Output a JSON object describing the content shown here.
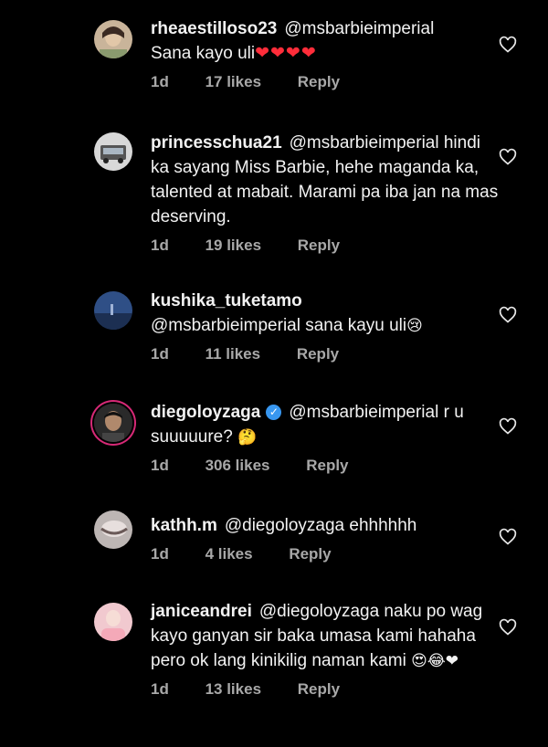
{
  "comments": [
    {
      "username": "rheaestilloso23",
      "text": "@msbarbieimperial\nSana kayo uli",
      "emojis": "❤❤❤❤",
      "age": "1d",
      "likes": "17 likes",
      "reply": "Reply",
      "verified": false
    },
    {
      "username": "princesschua21",
      "text": "@msbarbieimperial hindi ka sayang Miss Barbie, hehe maganda ka, talented at mabait. Marami pa iba jan na mas deserving.",
      "emojis": "",
      "age": "1d",
      "likes": "19 likes",
      "reply": "Reply",
      "verified": false
    },
    {
      "username": "kushika_tuketamo",
      "text": "@msbarbieimperial sana kayu uli",
      "emojis": "😢",
      "age": "1d",
      "likes": "11 likes",
      "reply": "Reply",
      "verified": false
    },
    {
      "username": "diegoloyzaga",
      "text": "@msbarbieimperial r u suuuuure?",
      "emojis": "🤔",
      "age": "1d",
      "likes": "306 likes",
      "reply": "Reply",
      "verified": true
    },
    {
      "username": "kathh.m",
      "text": "@diegoloyzaga ehhhhhh",
      "emojis": "",
      "age": "1d",
      "likes": "4 likes",
      "reply": "Reply",
      "verified": false
    },
    {
      "username": "janiceandrei",
      "text": "@diegoloyzaga naku po wag kayo ganyan sir baka umasa kami hahaha pero ok lang kinikilig naman kami",
      "emojis": "😍😂❤",
      "age": "1d",
      "likes": "13 likes",
      "reply": "Reply",
      "verified": false
    }
  ],
  "colors": {
    "accent_link": "#3897f0",
    "meta": "#a8a8a8",
    "background": "#000000"
  },
  "icons": {
    "like": "heart-outline-icon",
    "verified": "verified-badge-icon"
  }
}
